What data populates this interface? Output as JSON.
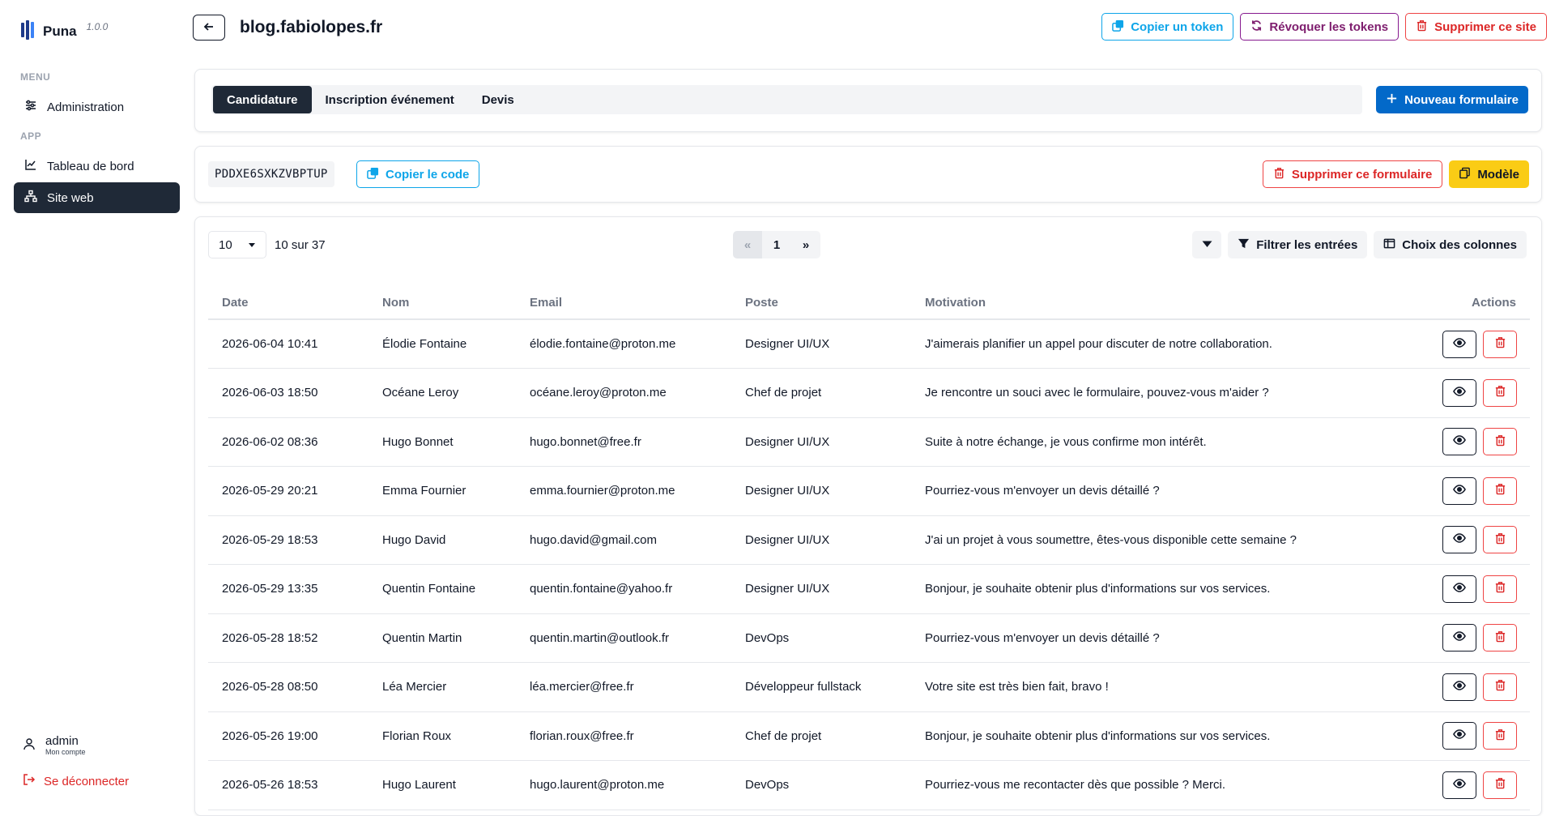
{
  "app": {
    "name": "Puna",
    "version": "1.0.0"
  },
  "sidebar": {
    "menu_section": "MENU",
    "app_section": "APP",
    "admin_label": "Administration",
    "dashboard_label": "Tableau de bord",
    "site_label": "Site web",
    "account_name": "admin",
    "account_sub": "Mon compte",
    "logout_label": "Se déconnecter"
  },
  "header": {
    "site_title": "blog.fabiolopes.fr",
    "copy_token": "Copier un token",
    "revoke_tokens": "Révoquer les tokens",
    "delete_site": "Supprimer ce site"
  },
  "tabs": [
    "Candidature",
    "Inscription événement",
    "Devis"
  ],
  "new_form": "Nouveau formulaire",
  "form_bar": {
    "code": "PDDXE6SXKZVBPTUP",
    "copy_code": "Copier le code",
    "delete_form": "Supprimer ce formulaire",
    "template": "Modèle"
  },
  "table_toolbar": {
    "page_size": "10",
    "count": "10 sur 37",
    "prev": "«",
    "page": "1",
    "next": "»",
    "filter": "Filtrer les entrées",
    "columns": "Choix des colonnes"
  },
  "columns": [
    "Date",
    "Nom",
    "Email",
    "Poste",
    "Motivation",
    "Actions"
  ],
  "rows": [
    [
      "2026-06-04 10:41",
      "Élodie Fontaine",
      "élodie.fontaine@proton.me",
      "Designer UI/UX",
      "J'aimerais planifier un appel pour discuter de notre collaboration."
    ],
    [
      "2026-06-03 18:50",
      "Océane Leroy",
      "océane.leroy@proton.me",
      "Chef de projet",
      "Je rencontre un souci avec le formulaire, pouvez-vous m'aider ?"
    ],
    [
      "2026-06-02 08:36",
      "Hugo Bonnet",
      "hugo.bonnet@free.fr",
      "Designer UI/UX",
      "Suite à notre échange, je vous confirme mon intérêt."
    ],
    [
      "2026-05-29 20:21",
      "Emma Fournier",
      "emma.fournier@proton.me",
      "Designer UI/UX",
      "Pourriez-vous m'envoyer un devis détaillé ?"
    ],
    [
      "2026-05-29 18:53",
      "Hugo David",
      "hugo.david@gmail.com",
      "Designer UI/UX",
      "J'ai un projet à vous soumettre, êtes-vous disponible cette semaine ?"
    ],
    [
      "2026-05-29 13:35",
      "Quentin Fontaine",
      "quentin.fontaine@yahoo.fr",
      "Designer UI/UX",
      "Bonjour, je souhaite obtenir plus d'informations sur vos services."
    ],
    [
      "2026-05-28 18:52",
      "Quentin Martin",
      "quentin.martin@outlook.fr",
      "DevOps",
      "Pourriez-vous m'envoyer un devis détaillé ?"
    ],
    [
      "2026-05-28 08:50",
      "Léa Mercier",
      "léa.mercier@free.fr",
      "Développeur fullstack",
      "Votre site est très bien fait, bravo !"
    ],
    [
      "2026-05-26 19:00",
      "Florian Roux",
      "florian.roux@free.fr",
      "Chef de projet",
      "Bonjour, je souhaite obtenir plus d'informations sur vos services."
    ],
    [
      "2026-05-26 18:53",
      "Hugo Laurent",
      "hugo.laurent@proton.me",
      "DevOps",
      "Pourriez-vous me recontacter dès que possible ? Merci."
    ]
  ],
  "colors": {
    "accent": "#0369c9",
    "cyan": "#0ea5e9",
    "danger": "#dc2626",
    "warning": "#facc15",
    "dark": "#1f2937"
  }
}
